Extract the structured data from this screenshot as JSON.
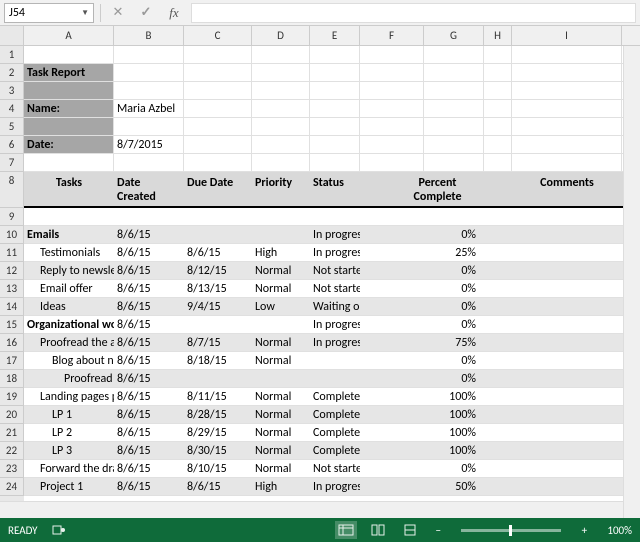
{
  "namebox": "J54",
  "colHeaders": [
    "A",
    "B",
    "C",
    "D",
    "E",
    "F",
    "G",
    "H",
    "I"
  ],
  "rowCount": 24,
  "report": {
    "title": "Task Report",
    "nameLabel": "Name:",
    "nameValue": "Maria Azbel",
    "dateLabel": "Date:",
    "dateValue": "8/7/2015"
  },
  "headers": {
    "tasks": "Tasks",
    "created": "Date Created",
    "due": "Due Date",
    "priority": "Priority",
    "status": "Status",
    "pct": "Percent Complete",
    "comments": "Comments"
  },
  "rows": [
    {
      "n": 10,
      "band": true,
      "ind": 0,
      "bold": true,
      "task": "Emails",
      "created": "8/6/15",
      "due": "",
      "pri": "",
      "status": "In progress",
      "pct": "0%"
    },
    {
      "n": 11,
      "band": false,
      "ind": 1,
      "bold": false,
      "task": "Testimonials",
      "created": "8/6/15",
      "due": "8/6/15",
      "pri": "High",
      "status": "In progress",
      "pct": "25%"
    },
    {
      "n": 12,
      "band": true,
      "ind": 1,
      "bold": false,
      "task": "Reply to newsletter",
      "created": "8/6/15",
      "due": "8/12/15",
      "pri": "Normal",
      "status": "Not started",
      "pct": "0%"
    },
    {
      "n": 13,
      "band": false,
      "ind": 1,
      "bold": false,
      "task": "Email offer",
      "created": "8/6/15",
      "due": "8/13/15",
      "pri": "Normal",
      "status": "Not started",
      "pct": "0%"
    },
    {
      "n": 14,
      "band": true,
      "ind": 1,
      "bold": false,
      "task": "Ideas",
      "created": "8/6/15",
      "due": "9/4/15",
      "pri": "Low",
      "status": "Waiting on",
      "pct": "0%"
    },
    {
      "n": 15,
      "band": false,
      "ind": 0,
      "bold": true,
      "task": "Organizational work",
      "created": "8/6/15",
      "due": "",
      "pri": "",
      "status": "In progress",
      "pct": "0%"
    },
    {
      "n": 16,
      "band": true,
      "ind": 1,
      "bold": false,
      "task": "Proofread the article about",
      "created": "8/6/15",
      "due": "8/7/15",
      "pri": "Normal",
      "status": "In progress",
      "pct": "75%"
    },
    {
      "n": 17,
      "band": false,
      "ind": 2,
      "bold": false,
      "task": "Blog about new add-in",
      "created": "8/6/15",
      "due": "8/18/15",
      "pri": "Normal",
      "status": "",
      "pct": "0%"
    },
    {
      "n": 18,
      "band": true,
      "ind": 3,
      "bold": false,
      "task": "Proofread the article",
      "created": "8/6/15",
      "due": "",
      "pri": "",
      "status": "",
      "pct": "0%"
    },
    {
      "n": 19,
      "band": false,
      "ind": 1,
      "bold": false,
      "task": "Landing pages proofreading",
      "created": "8/6/15",
      "due": "8/11/15",
      "pri": "Normal",
      "status": "Completed",
      "pct": "100%"
    },
    {
      "n": 20,
      "band": true,
      "ind": 2,
      "bold": false,
      "task": "LP 1",
      "created": "8/6/15",
      "due": "8/28/15",
      "pri": "Normal",
      "status": "Completed",
      "pct": "100%"
    },
    {
      "n": 21,
      "band": false,
      "ind": 2,
      "bold": false,
      "task": "LP 2",
      "created": "8/6/15",
      "due": "8/29/15",
      "pri": "Normal",
      "status": "Completed",
      "pct": "100%"
    },
    {
      "n": 22,
      "band": true,
      "ind": 2,
      "bold": false,
      "task": "LP 3",
      "created": "8/6/15",
      "due": "8/30/15",
      "pri": "Normal",
      "status": "Completed",
      "pct": "100%"
    },
    {
      "n": 23,
      "band": false,
      "ind": 1,
      "bold": false,
      "task": "Forward the drafts to",
      "created": "8/6/15",
      "due": "8/10/15",
      "pri": "Normal",
      "status": "Not started",
      "pct": "0%"
    },
    {
      "n": 24,
      "band": true,
      "ind": 1,
      "bold": false,
      "task": "Project 1",
      "created": "8/6/15",
      "due": "8/6/15",
      "pri": "High",
      "status": "In progress",
      "pct": "50%"
    }
  ],
  "status": {
    "ready": "READY",
    "zoom": "100%"
  }
}
